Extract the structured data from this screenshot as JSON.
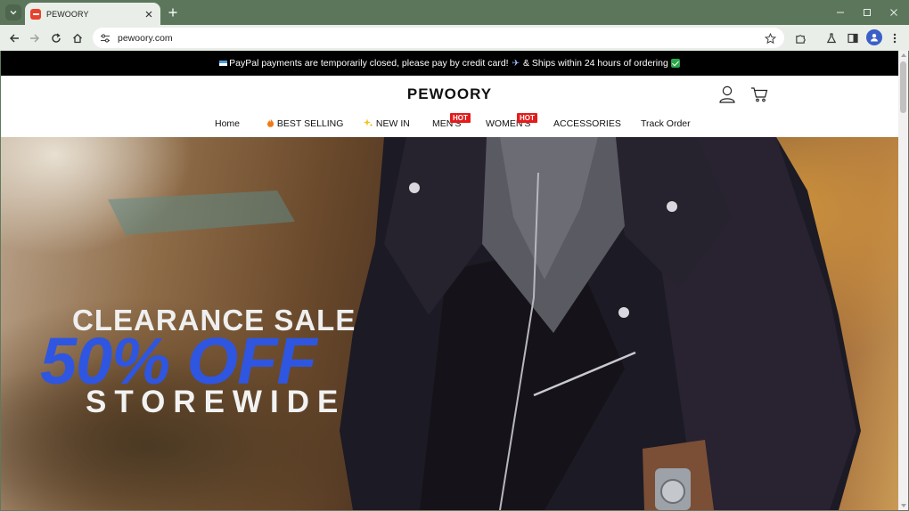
{
  "browser": {
    "tab": {
      "title": "PEWOORY"
    },
    "url": "pewoory.com"
  },
  "announcement": {
    "text_before": "PayPal payments are temporarily closed, please pay by credit card!",
    "text_after": "& Ships within 24 hours of ordering"
  },
  "site": {
    "logo": "PEWOORY"
  },
  "nav": {
    "items": [
      {
        "label": "Home"
      },
      {
        "label": "BEST SELLING",
        "icon": "fire-icon"
      },
      {
        "label": "NEW IN",
        "icon": "sparkles-icon"
      },
      {
        "label": "MEN'S",
        "badge": "HOT"
      },
      {
        "label": "WOMEN'S",
        "badge": "HOT"
      },
      {
        "label": "ACCESSORIES"
      },
      {
        "label": "Track Order"
      }
    ]
  },
  "hero": {
    "line1": "CLEARANCE SALE",
    "line2": "50% OFF",
    "line3": "STOREWIDE"
  },
  "colors": {
    "announcement_bg": "#000000",
    "hot_badge": "#e51b1b",
    "offer_text": "#2f56e0",
    "chrome_frame": "#5c765c"
  }
}
